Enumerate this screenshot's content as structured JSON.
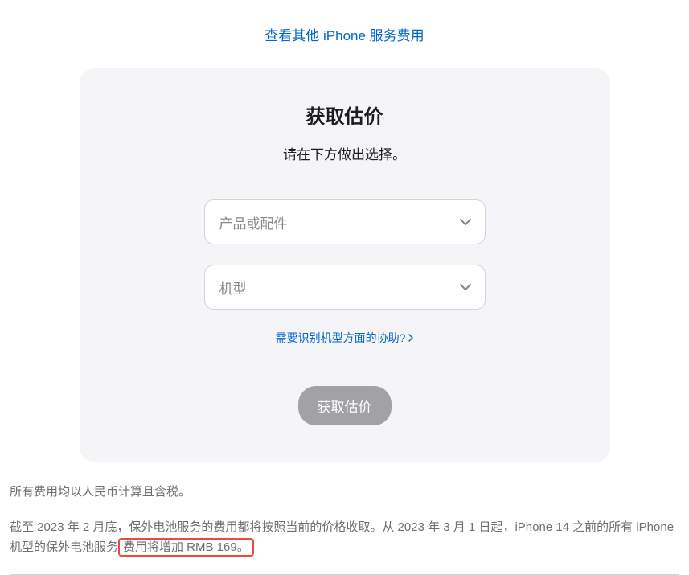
{
  "topLink": {
    "label": "查看其他 iPhone 服务费用"
  },
  "card": {
    "title": "获取估价",
    "subtitle": "请在下方做出选择。",
    "select1": {
      "placeholder": "产品或配件"
    },
    "select2": {
      "placeholder": "机型"
    },
    "helpLink": {
      "label": "需要识别机型方面的协助?"
    },
    "button": {
      "label": "获取估价"
    }
  },
  "footer": {
    "p1": "所有费用均以人民币计算且含税。",
    "p2_pre": "截至 2023 年 2 月底，保外电池服务的费用都将按照当前的价格收取。从 2023 年 3 月 1 日起，iPhone 14 之前的所有 iPhone 机型的保外电池服务",
    "p2_highlight": "费用将增加 RMB 169。"
  }
}
